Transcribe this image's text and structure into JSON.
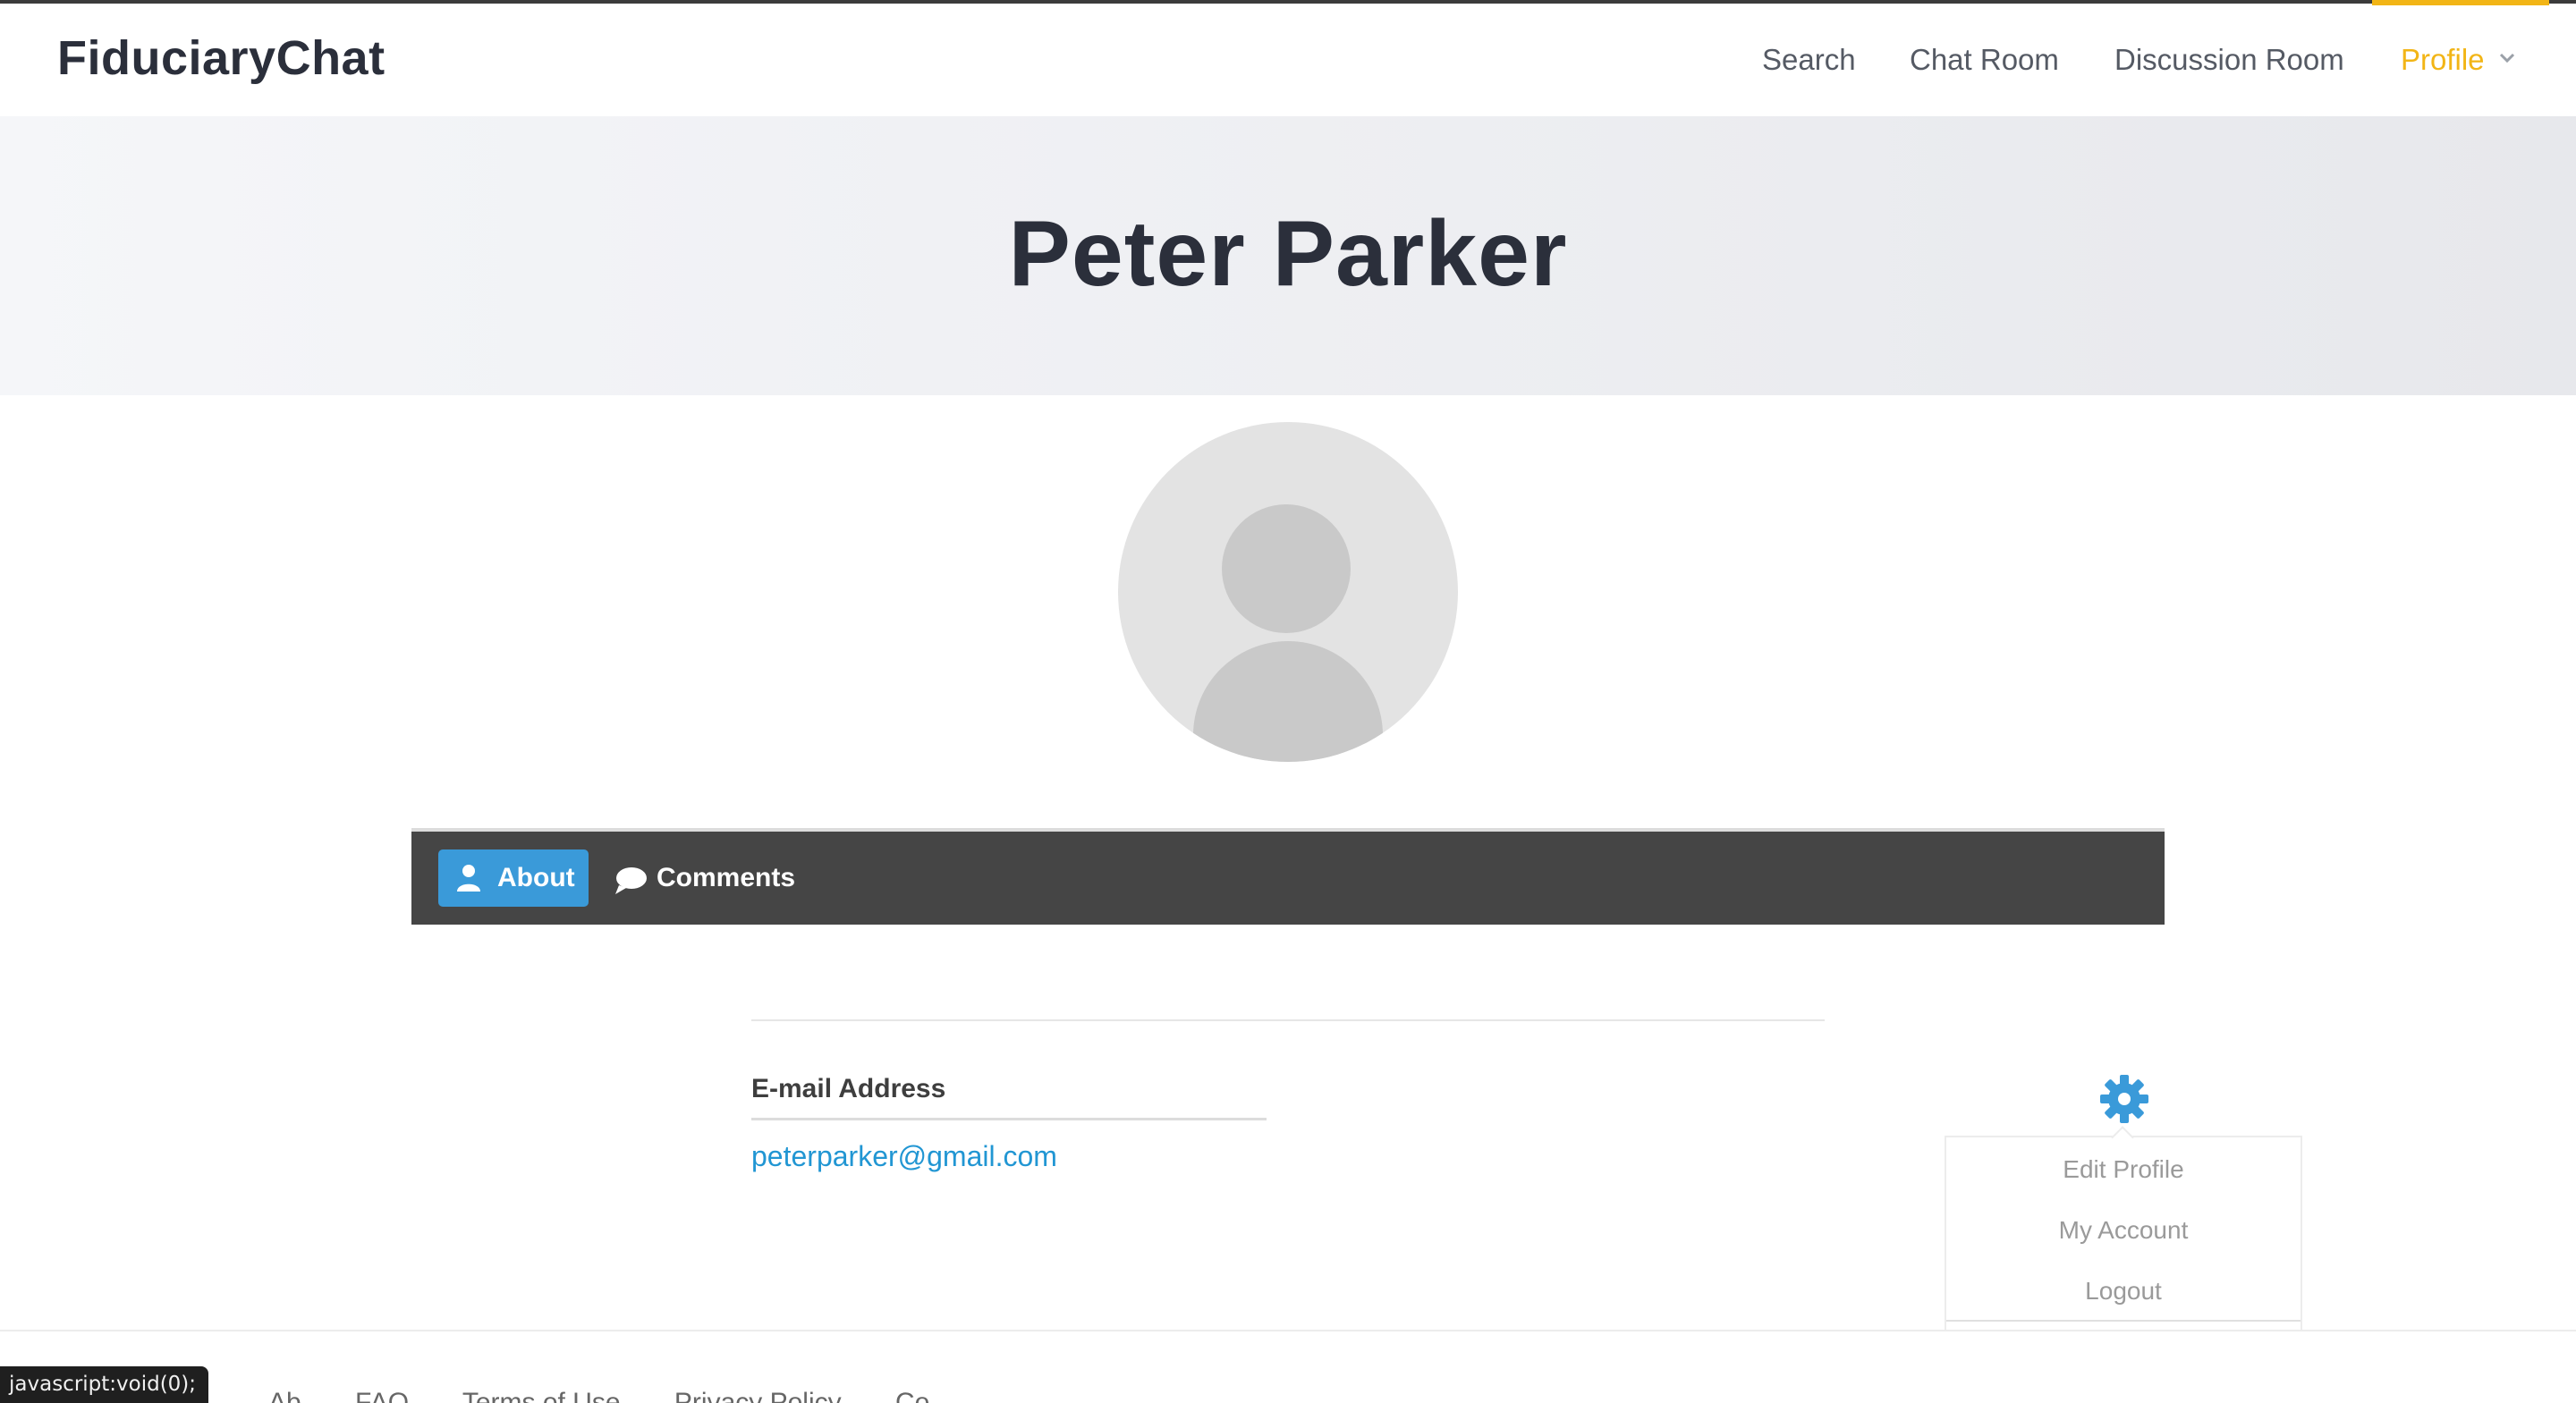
{
  "header": {
    "brand": "FiduciaryChat",
    "nav": {
      "search": "Search",
      "chat_room": "Chat Room",
      "discussion_room": "Discussion Room",
      "profile": "Profile"
    },
    "active_color": "#f2b516"
  },
  "hero": {
    "title": "Peter Parker"
  },
  "avatar": {
    "icon": "default-user-avatar"
  },
  "tabs": {
    "about": "About",
    "comments": "Comments",
    "active": "About",
    "active_color": "#3a9ad9"
  },
  "about": {
    "email_label": "E-mail Address",
    "email_value": "peterparker@gmail.com"
  },
  "settings_menu": {
    "icon": "gear-icon",
    "items": [
      "Edit Profile",
      "My Account",
      "Logout"
    ]
  },
  "footer": {
    "links": [
      "Ab",
      "FAQ",
      "Terms of Use",
      "Privacy Policy",
      "Co"
    ]
  },
  "status_bar": {
    "text": "javascript:void(0);"
  }
}
